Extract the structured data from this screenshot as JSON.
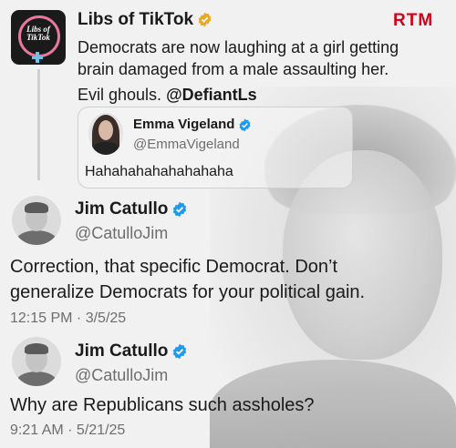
{
  "brand": {
    "watermark": "RTM",
    "color": "#d0021b"
  },
  "post1": {
    "avatar_text": "Libs of TikTok",
    "name": "Libs of TikTok",
    "text_line1": "Democrats are now laughing at a girl getting",
    "text_line2": "brain damaged from a male assaulting her.",
    "text_line3_plain": "Evil ghouls. ",
    "text_line3_handle": "@DefiantLs"
  },
  "quote": {
    "name": "Emma Vigeland",
    "handle": "@EmmaVigeland",
    "text": "Hahahahahahahahaha"
  },
  "post2": {
    "name": "Jim Catullo",
    "handle": "@CatulloJim",
    "text_line1": "Correction, that specific Democrat. Don’t",
    "text_line2": "generalize Democrats for your political gain.",
    "time": "12:15 PM · 3/5/25"
  },
  "post3": {
    "name": "Jim Catullo",
    "handle": "@CatulloJim",
    "text": "Why are Republicans such assholes?",
    "time": "9:21 AM · 5/21/25"
  },
  "colors": {
    "verified_gold": "#e8a72b",
    "verified_blue": "#1d9bf0"
  }
}
